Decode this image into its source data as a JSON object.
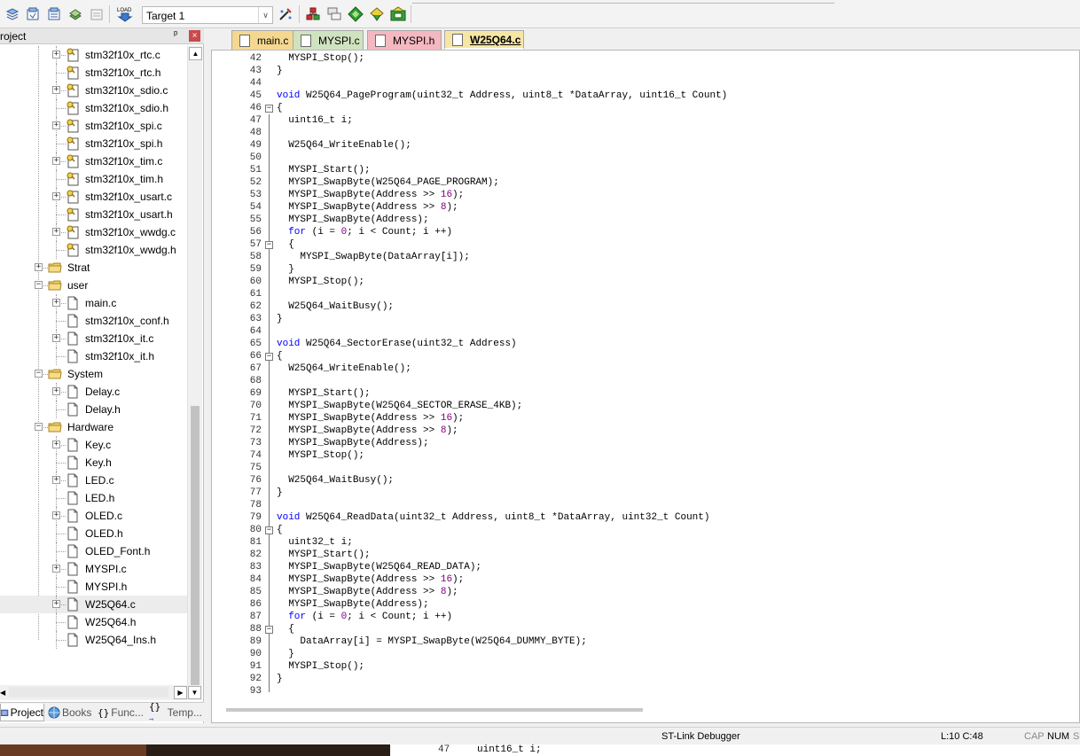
{
  "toolbar": {
    "target": "Target 1"
  },
  "project_panel": {
    "title": "roject",
    "pin": "ᵖ",
    "close": "×",
    "tree": [
      {
        "label": "stm32f10x_rtc.c",
        "level": 3,
        "expandable": true,
        "type": "c"
      },
      {
        "label": "stm32f10x_rtc.h",
        "level": 3,
        "expandable": false,
        "type": "h"
      },
      {
        "label": "stm32f10x_sdio.c",
        "level": 3,
        "expandable": true,
        "type": "c"
      },
      {
        "label": "stm32f10x_sdio.h",
        "level": 3,
        "expandable": false,
        "type": "h"
      },
      {
        "label": "stm32f10x_spi.c",
        "level": 3,
        "expandable": true,
        "type": "c"
      },
      {
        "label": "stm32f10x_spi.h",
        "level": 3,
        "expandable": false,
        "type": "h"
      },
      {
        "label": "stm32f10x_tim.c",
        "level": 3,
        "expandable": true,
        "type": "c"
      },
      {
        "label": "stm32f10x_tim.h",
        "level": 3,
        "expandable": false,
        "type": "h"
      },
      {
        "label": "stm32f10x_usart.c",
        "level": 3,
        "expandable": true,
        "type": "c"
      },
      {
        "label": "stm32f10x_usart.h",
        "level": 3,
        "expandable": false,
        "type": "h"
      },
      {
        "label": "stm32f10x_wwdg.c",
        "level": 3,
        "expandable": true,
        "type": "c"
      },
      {
        "label": "stm32f10x_wwdg.h",
        "level": 3,
        "expandable": false,
        "type": "h"
      },
      {
        "label": "Strat",
        "level": 2,
        "expandable": true,
        "expanded": false,
        "type": "folder"
      },
      {
        "label": "user",
        "level": 2,
        "expandable": true,
        "expanded": true,
        "type": "folder"
      },
      {
        "label": "main.c",
        "level": 3,
        "expandable": true,
        "type": "file"
      },
      {
        "label": "stm32f10x_conf.h",
        "level": 3,
        "expandable": false,
        "type": "file"
      },
      {
        "label": "stm32f10x_it.c",
        "level": 3,
        "expandable": true,
        "type": "file"
      },
      {
        "label": "stm32f10x_it.h",
        "level": 3,
        "expandable": false,
        "type": "file"
      },
      {
        "label": "System",
        "level": 2,
        "expandable": true,
        "expanded": true,
        "type": "folder"
      },
      {
        "label": "Delay.c",
        "level": 3,
        "expandable": true,
        "type": "file"
      },
      {
        "label": "Delay.h",
        "level": 3,
        "expandable": false,
        "type": "file"
      },
      {
        "label": "Hardware",
        "level": 2,
        "expandable": true,
        "expanded": true,
        "type": "folder"
      },
      {
        "label": "Key.c",
        "level": 3,
        "expandable": true,
        "type": "file"
      },
      {
        "label": "Key.h",
        "level": 3,
        "expandable": false,
        "type": "file"
      },
      {
        "label": "LED.c",
        "level": 3,
        "expandable": true,
        "type": "file"
      },
      {
        "label": "LED.h",
        "level": 3,
        "expandable": false,
        "type": "file"
      },
      {
        "label": "OLED.c",
        "level": 3,
        "expandable": true,
        "type": "file"
      },
      {
        "label": "OLED.h",
        "level": 3,
        "expandable": false,
        "type": "file"
      },
      {
        "label": "OLED_Font.h",
        "level": 3,
        "expandable": false,
        "type": "file"
      },
      {
        "label": "MYSPI.c",
        "level": 3,
        "expandable": true,
        "type": "file"
      },
      {
        "label": "MYSPI.h",
        "level": 3,
        "expandable": false,
        "type": "file"
      },
      {
        "label": "W25Q64.c",
        "level": 3,
        "expandable": true,
        "type": "file",
        "selected": true
      },
      {
        "label": "W25Q64.h",
        "level": 3,
        "expandable": false,
        "type": "file"
      },
      {
        "label": "W25Q64_Ins.h",
        "level": 3,
        "expandable": false,
        "type": "file"
      }
    ],
    "tabs": [
      {
        "label": "Project",
        "icon": "project-icon",
        "active": true
      },
      {
        "label": "Books",
        "icon": "books-icon",
        "active": false
      },
      {
        "label": "Func...",
        "icon": "{}",
        "active": false
      },
      {
        "label": "Temp...",
        "icon": "{}→",
        "active": false
      }
    ]
  },
  "editor": {
    "tabs": [
      {
        "label": "main.c",
        "color": "#f5d890",
        "active": false
      },
      {
        "label": "MYSPI.c",
        "color": "#cfe3c0",
        "active": false
      },
      {
        "label": "MYSPI.h",
        "color": "#f4b8c0",
        "active": false
      },
      {
        "label": "W25Q64.c",
        "color": "#f6e6a6",
        "active": true
      }
    ],
    "lines": [
      {
        "n": "42",
        "fold": "",
        "code": "  MYSPI_Stop();"
      },
      {
        "n": "43",
        "fold": "",
        "code": "}"
      },
      {
        "n": "44",
        "fold": "",
        "code": ""
      },
      {
        "n": "45",
        "fold": "",
        "code": "void W25Q64_PageProgram(uint32_t Address, uint8_t *DataArray, uint16_t Count)"
      },
      {
        "n": "46",
        "fold": "-",
        "code": "{"
      },
      {
        "n": "47",
        "fold": "",
        "code": "  uint16_t i;"
      },
      {
        "n": "48",
        "fold": "",
        "code": ""
      },
      {
        "n": "49",
        "fold": "",
        "code": "  W25Q64_WriteEnable();"
      },
      {
        "n": "50",
        "fold": "",
        "code": ""
      },
      {
        "n": "51",
        "fold": "",
        "code": "  MYSPI_Start();"
      },
      {
        "n": "52",
        "fold": "",
        "code": "  MYSPI_SwapByte(W25Q64_PAGE_PROGRAM);"
      },
      {
        "n": "53",
        "fold": "",
        "code": "  MYSPI_SwapByte(Address >> 16);"
      },
      {
        "n": "54",
        "fold": "",
        "code": "  MYSPI_SwapByte(Address >> 8);"
      },
      {
        "n": "55",
        "fold": "",
        "code": "  MYSPI_SwapByte(Address);"
      },
      {
        "n": "56",
        "fold": "",
        "code": "  for (i = 0; i < Count; i ++)"
      },
      {
        "n": "57",
        "fold": "-",
        "code": "  {"
      },
      {
        "n": "58",
        "fold": "",
        "code": "    MYSPI_SwapByte(DataArray[i]);"
      },
      {
        "n": "59",
        "fold": "",
        "code": "  }"
      },
      {
        "n": "60",
        "fold": "",
        "code": "  MYSPI_Stop();"
      },
      {
        "n": "61",
        "fold": "",
        "code": ""
      },
      {
        "n": "62",
        "fold": "",
        "code": "  W25Q64_WaitBusy();"
      },
      {
        "n": "63",
        "fold": "",
        "code": "}"
      },
      {
        "n": "64",
        "fold": "",
        "code": ""
      },
      {
        "n": "65",
        "fold": "",
        "code": "void W25Q64_SectorErase(uint32_t Address)"
      },
      {
        "n": "66",
        "fold": "-",
        "code": "{"
      },
      {
        "n": "67",
        "fold": "",
        "code": "  W25Q64_WriteEnable();"
      },
      {
        "n": "68",
        "fold": "",
        "code": ""
      },
      {
        "n": "69",
        "fold": "",
        "code": "  MYSPI_Start();"
      },
      {
        "n": "70",
        "fold": "",
        "code": "  MYSPI_SwapByte(W25Q64_SECTOR_ERASE_4KB);"
      },
      {
        "n": "71",
        "fold": "",
        "code": "  MYSPI_SwapByte(Address >> 16);"
      },
      {
        "n": "72",
        "fold": "",
        "code": "  MYSPI_SwapByte(Address >> 8);"
      },
      {
        "n": "73",
        "fold": "",
        "code": "  MYSPI_SwapByte(Address);"
      },
      {
        "n": "74",
        "fold": "",
        "code": "  MYSPI_Stop();"
      },
      {
        "n": "75",
        "fold": "",
        "code": ""
      },
      {
        "n": "76",
        "fold": "",
        "code": "  W25Q64_WaitBusy();"
      },
      {
        "n": "77",
        "fold": "",
        "code": "}"
      },
      {
        "n": "78",
        "fold": "",
        "code": ""
      },
      {
        "n": "79",
        "fold": "",
        "code": "void W25Q64_ReadData(uint32_t Address, uint8_t *DataArray, uint32_t Count)"
      },
      {
        "n": "80",
        "fold": "-",
        "code": "{"
      },
      {
        "n": "81",
        "fold": "",
        "code": "  uint32_t i;"
      },
      {
        "n": "82",
        "fold": "",
        "code": "  MYSPI_Start();"
      },
      {
        "n": "83",
        "fold": "",
        "code": "  MYSPI_SwapByte(W25Q64_READ_DATA);"
      },
      {
        "n": "84",
        "fold": "",
        "code": "  MYSPI_SwapByte(Address >> 16);"
      },
      {
        "n": "85",
        "fold": "",
        "code": "  MYSPI_SwapByte(Address >> 8);"
      },
      {
        "n": "86",
        "fold": "",
        "code": "  MYSPI_SwapByte(Address);"
      },
      {
        "n": "87",
        "fold": "",
        "code": "  for (i = 0; i < Count; i ++)"
      },
      {
        "n": "88",
        "fold": "-",
        "code": "  {"
      },
      {
        "n": "89",
        "fold": "",
        "code": "    DataArray[i] = MYSPI_SwapByte(W25Q64_DUMMY_BYTE);"
      },
      {
        "n": "90",
        "fold": "",
        "code": "  }"
      },
      {
        "n": "91",
        "fold": "",
        "code": "  MYSPI_Stop();"
      },
      {
        "n": "92",
        "fold": "",
        "code": "}"
      },
      {
        "n": "93",
        "fold": "",
        "code": ""
      }
    ]
  },
  "statusbar": {
    "debugger": "ST-Link Debugger",
    "position": "L:10 C:48",
    "cap": "CAP",
    "num": "NUM",
    "extra": "S"
  },
  "background_window": {
    "line_number": "47",
    "code": "uint16_t i;"
  },
  "colors": {
    "keyword": "#0000ff",
    "number": "#800080",
    "text": "#000000"
  }
}
